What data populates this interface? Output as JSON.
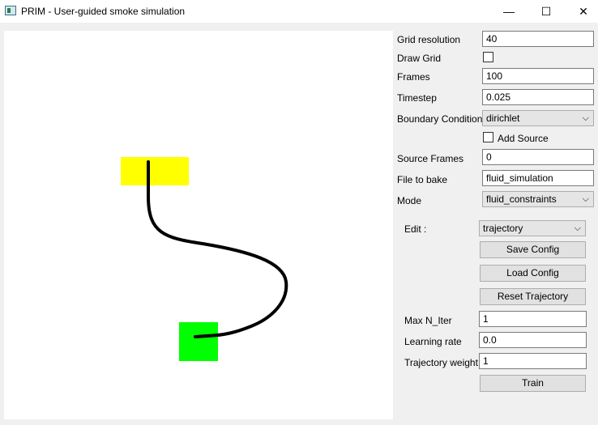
{
  "window": {
    "title": "PRIM - User-guided smoke simulation",
    "icons": [
      "app-icon",
      "minimize-icon",
      "maximize-icon",
      "close-icon"
    ],
    "controls": {
      "minimize": "—",
      "maximize": "☐",
      "close": "✕"
    }
  },
  "settings": {
    "grid_resolution": {
      "label": "Grid resolution",
      "value": "40"
    },
    "draw_grid": {
      "label": "Draw Grid",
      "checked": false
    },
    "frames": {
      "label": "Frames",
      "value": "100"
    },
    "timestep": {
      "label": "Timestep",
      "value": "0.025"
    },
    "boundary_conditions": {
      "label": "Boundary Conditions",
      "value": "dirichlet"
    },
    "add_source": {
      "label": "Add Source",
      "checked": false
    },
    "source_frames": {
      "label": "Source Frames",
      "value": "0"
    },
    "file_to_bake": {
      "label": "File to bake",
      "value": "fluid_simulation"
    },
    "mode": {
      "label": "Mode",
      "value": "fluid_constraints"
    }
  },
  "edit_panel": {
    "edit": {
      "label": "Edit :",
      "value": "trajectory"
    },
    "save_config": "Save Config",
    "load_config": "Load Config",
    "reset_trajectory": "Reset Trajectory",
    "max_n_iter": {
      "label": "Max N_Iter",
      "value": "1"
    },
    "learning_rate": {
      "label": "Learning rate",
      "value": "0.0"
    },
    "trajectory_weight": {
      "label": "Trajectory weight",
      "value": "1"
    },
    "train": "Train"
  },
  "canvas": {
    "colors": {
      "source": "#ffff00",
      "target": "#00ff00",
      "trajectory": "#000000",
      "background": "#ffffff"
    }
  }
}
